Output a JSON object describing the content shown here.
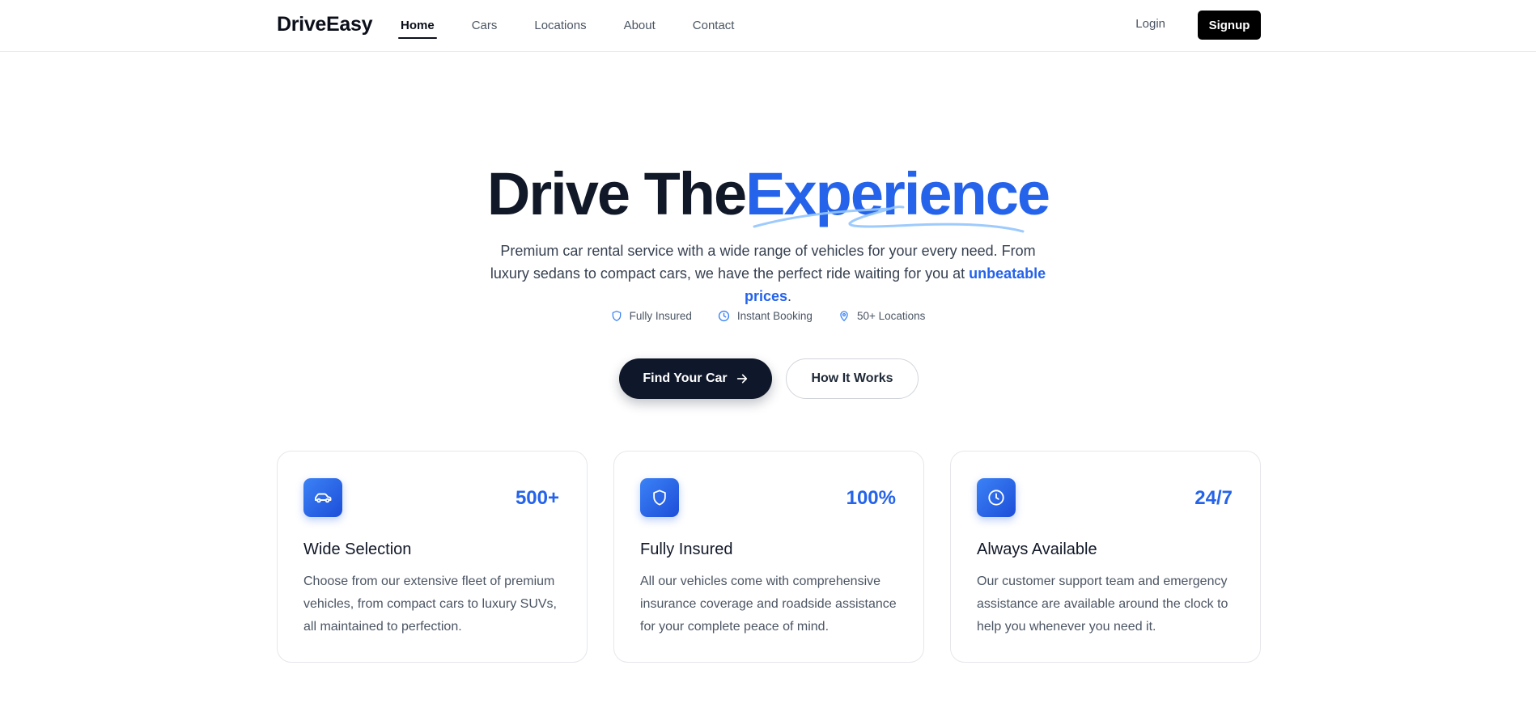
{
  "nav": {
    "brand": "DriveEasy",
    "links": [
      "Home",
      "Cars",
      "Locations",
      "About",
      "Contact"
    ],
    "active_link": "Home",
    "login_label": "Login",
    "signup_label": "Signup"
  },
  "hero": {
    "title_part1": "Drive The",
    "title_accent": "Experience",
    "subtitle_text": "Premium car rental service with a wide range of vehicles for your every need. From luxury sedans to compact cars, we have the perfect ride waiting for you at ",
    "subtitle_link": "unbeatable prices",
    "subtitle_end": ".",
    "badges": [
      {
        "icon": "shield-icon",
        "label": "Fully Insured"
      },
      {
        "icon": "clock-icon",
        "label": "Instant Booking"
      },
      {
        "icon": "map-pin-icon",
        "label": "50+ Locations"
      }
    ],
    "primary_cta": "Find Your Car",
    "secondary_cta": "How It Works"
  },
  "features": [
    {
      "icon": "car-icon",
      "stat": "500+",
      "title": "Wide Selection",
      "description": "Choose from our extensive fleet of premium vehicles, from compact cars to luxury SUVs, all maintained to perfection."
    },
    {
      "icon": "shield-icon",
      "stat": "100%",
      "title": "Fully Insured",
      "description": "All our vehicles come with comprehensive insurance coverage and roadside assistance for your complete peace of mind."
    },
    {
      "icon": "clock-icon",
      "stat": "24/7",
      "title": "Always Available",
      "description": "Our customer support team and emergency assistance are available around the clock to help you whenever you need it."
    }
  ],
  "colors": {
    "accent": "#2563eb",
    "dark": "#0f172a",
    "muted": "#4b5563"
  }
}
